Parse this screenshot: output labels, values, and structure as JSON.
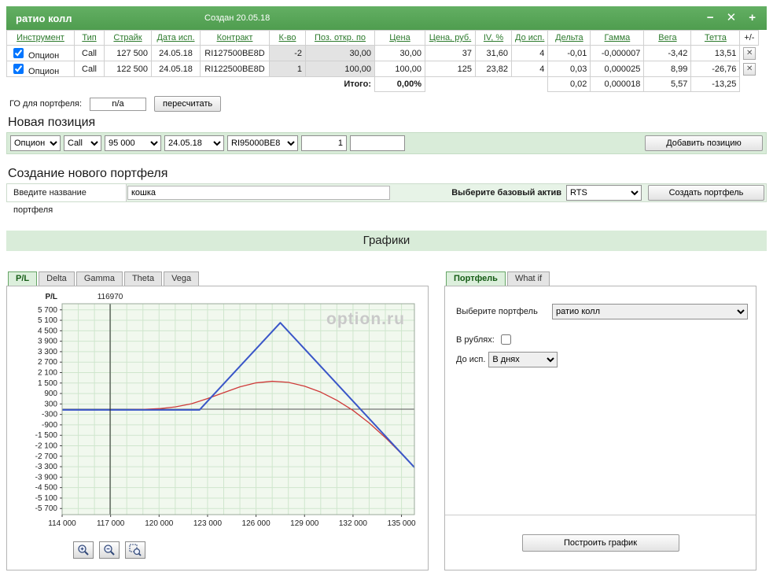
{
  "window": {
    "title": "ратио колл",
    "created": "Создан 20.05.18",
    "icons": {
      "minimize": "−",
      "close": "✕",
      "add": "+"
    }
  },
  "positions_table": {
    "columns": [
      "Инструмент",
      "Тип",
      "Страйк",
      "Дата исп.",
      "Контракт",
      "К-во",
      "Поз. откр. по",
      "Цена",
      "Цена, руб.",
      "IV, %",
      "До исп.",
      "Дельта",
      "Гамма",
      "Вега",
      "Тетта",
      "+/-"
    ],
    "column_keys": [
      "instrument",
      "type",
      "strike",
      "exp_date",
      "contract",
      "qty",
      "open_at",
      "price",
      "price_rub",
      "iv",
      "days",
      "delta",
      "gamma",
      "vega",
      "theta",
      "remove"
    ],
    "rows": [
      {
        "checked": true,
        "instrument": "Опцион",
        "type": "Call",
        "strike": "127 500",
        "exp_date": "24.05.18",
        "contract": "RI127500BE8D",
        "qty": "-2",
        "open_at": "30,00",
        "price": "30,00",
        "price_rub": "37",
        "iv": "31,60",
        "days": "4",
        "delta": "-0,01",
        "gamma": "-0,000007",
        "vega": "-3,42",
        "theta": "13,51",
        "remove": "✕"
      },
      {
        "checked": true,
        "instrument": "Опцион",
        "type": "Call",
        "strike": "122 500",
        "exp_date": "24.05.18",
        "contract": "RI122500BE8D",
        "qty": "1",
        "open_at": "100,00",
        "price": "100,00",
        "price_rub": "125",
        "iv": "23,82",
        "days": "4",
        "delta": "0,03",
        "gamma": "0,000025",
        "vega": "8,99",
        "theta": "-26,76",
        "remove": "✕"
      }
    ],
    "totals": {
      "label": "Итого:",
      "percent": "0,00%",
      "delta": "0,02",
      "gamma": "0,000018",
      "vega": "5,57",
      "theta": "-13,25"
    }
  },
  "margin_row": {
    "label": "ГО для портфеля:",
    "value": "n/a",
    "recalc_button": "пересчитать"
  },
  "new_position": {
    "heading": "Новая позиция",
    "instrument": "Опцион",
    "type": "Call",
    "strike": "95 000",
    "exp_date": "24.05.18",
    "contract": "RI95000BE8",
    "qty": "1",
    "add_button": "Добавить позицию"
  },
  "new_portfolio": {
    "heading": "Создание нового портфеля",
    "name_label": "Введите название портфеля",
    "name_value": "кошка",
    "asset_label": "Выберите базовый актив",
    "asset_value": "RTS",
    "create_button": "Создать портфель"
  },
  "charts_section": {
    "heading": "Графики",
    "left_tabs": [
      "P/L",
      "Delta",
      "Gamma",
      "Theta",
      "Vega"
    ],
    "left_active_tab": "P/L",
    "right_tabs": [
      "Портфель",
      "What if"
    ],
    "right_active_tab": "Портфель",
    "portfolio_label": "Выберите портфель",
    "portfolio_value": "ратио колл",
    "rubles_label": "В рублях:",
    "rubles_checked": false,
    "days_label": "До исп.",
    "days_value": "В днях",
    "build_button": "Построить график"
  },
  "chart_data": {
    "type": "line",
    "axis_title": "P/L",
    "watermark": "option.ru",
    "marker": {
      "x": 116970,
      "label": "116970"
    },
    "x_range": [
      114000,
      135800
    ],
    "y_range": [
      -6050,
      6050
    ],
    "x_minor_step": 1000,
    "zero_line": 0,
    "x_ticks": [
      {
        "v": 114000,
        "label": "114 000"
      },
      {
        "v": 117000,
        "label": "117 000"
      },
      {
        "v": 120000,
        "label": "120 000"
      },
      {
        "v": 123000,
        "label": "123 000"
      },
      {
        "v": 126000,
        "label": "126 000"
      },
      {
        "v": 129000,
        "label": "129 000"
      },
      {
        "v": 132000,
        "label": "132 000"
      },
      {
        "v": 135000,
        "label": "135 000"
      }
    ],
    "y_ticks": [
      {
        "v": 5700,
        "label": "5 700"
      },
      {
        "v": 5100,
        "label": "5 100"
      },
      {
        "v": 4500,
        "label": "4 500"
      },
      {
        "v": 3900,
        "label": "3 900"
      },
      {
        "v": 3300,
        "label": "3 300"
      },
      {
        "v": 2700,
        "label": "2 700"
      },
      {
        "v": 2100,
        "label": "2 100"
      },
      {
        "v": 1500,
        "label": "1 500"
      },
      {
        "v": 900,
        "label": "900"
      },
      {
        "v": 300,
        "label": "300"
      },
      {
        "v": -300,
        "label": "-300"
      },
      {
        "v": -900,
        "label": "-900"
      },
      {
        "v": -1500,
        "label": "-1 500"
      },
      {
        "v": -2100,
        "label": "-2 100"
      },
      {
        "v": -2700,
        "label": "-2 700"
      },
      {
        "v": -3300,
        "label": "-3 300"
      },
      {
        "v": -3900,
        "label": "-3 900"
      },
      {
        "v": -4500,
        "label": "-4 500"
      },
      {
        "v": -5100,
        "label": "-5 100"
      },
      {
        "v": -5700,
        "label": "-5 700"
      }
    ],
    "series": [
      {
        "name": "current-pl-curve",
        "color": "#cf3a3a",
        "width": 1.3,
        "points": [
          [
            114000,
            -40
          ],
          [
            116000,
            -42
          ],
          [
            117500,
            -35
          ],
          [
            119000,
            -10
          ],
          [
            120000,
            30
          ],
          [
            121000,
            130
          ],
          [
            122000,
            310
          ],
          [
            123000,
            610
          ],
          [
            124000,
            950
          ],
          [
            125000,
            1280
          ],
          [
            126000,
            1510
          ],
          [
            127000,
            1600
          ],
          [
            128000,
            1540
          ],
          [
            129000,
            1320
          ],
          [
            130000,
            980
          ],
          [
            131000,
            510
          ],
          [
            132000,
            -70
          ],
          [
            133000,
            -790
          ],
          [
            134000,
            -1630
          ],
          [
            135000,
            -2560
          ],
          [
            135800,
            -3340
          ]
        ]
      },
      {
        "name": "expiration-payoff",
        "color": "#3a56c8",
        "width": 2,
        "points": [
          [
            114000,
            -40
          ],
          [
            122500,
            -40
          ],
          [
            127500,
            4960
          ],
          [
            135800,
            -3340
          ]
        ]
      }
    ],
    "colors": {
      "plot_bg": "#f1f8ee",
      "grid": "#cfe6cd",
      "axis": "#9aa89a",
      "zero_line": "#555555",
      "marker_line": "#222222"
    }
  },
  "theme": {
    "header_green": "#57a757",
    "band_green": "#d9ecd9",
    "link_green": "#2c7a2c"
  }
}
